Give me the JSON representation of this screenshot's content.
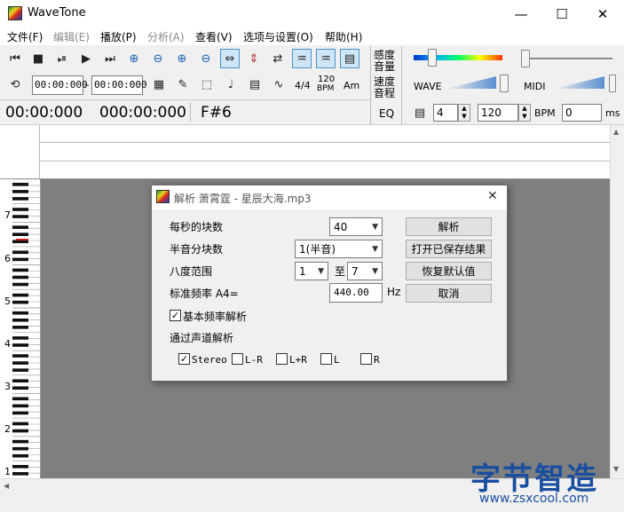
{
  "window": {
    "title": "WaveTone",
    "minimize": "—",
    "maximize": "☐",
    "close": "✕"
  },
  "menu": [
    {
      "label": "文件(F)",
      "enabled": true
    },
    {
      "label": "编辑(E)",
      "enabled": false
    },
    {
      "label": "播放(P)",
      "enabled": true
    },
    {
      "label": "分析(A)",
      "enabled": false
    },
    {
      "label": "查看(V)",
      "enabled": true
    },
    {
      "label": "选项与设置(O)",
      "enabled": true
    },
    {
      "label": "帮助(H)",
      "enabled": true
    }
  ],
  "toolbar": {
    "row1_icons": [
      "rewind-icon",
      "stop-icon",
      "pause-icon",
      "play-icon",
      "fast-forward-icon",
      "zoom-in-h-icon",
      "zoom-out-h-icon",
      "zoom-in-v-icon",
      "zoom-out-v-icon",
      "fit-h-icon",
      "fit-v-icon",
      "swap-icon",
      "wave-stereo-icon",
      "wave-mono-icon",
      "book-icon"
    ],
    "loop_icon": "loop-icon",
    "start_time": "00:00:000",
    "end_time": "00:00:000",
    "time_sep": "–",
    "meter_label": "4/4",
    "bpm_label": "120",
    "bpm_sub": "BPM",
    "am_label": "Am",
    "position_time": "00:00:000",
    "length_time": "000:00:000",
    "note": "F#6",
    "sensitivity_label1": "感度",
    "sensitivity_label2": "音量",
    "speed_label1": "速度",
    "speed_label2": "音程",
    "eq_label": "EQ",
    "wave_label": "WAVE",
    "midi_label": "MIDI",
    "beat_value": "4",
    "bpm_value": "120",
    "bpm_unit": "BPM",
    "ms_value": "0",
    "ms_unit": "ms"
  },
  "piano": {
    "octaves": [
      "7",
      "6",
      "5",
      "4",
      "3",
      "2",
      "1"
    ]
  },
  "dialog": {
    "title": "解析 萧霄霆 - 星辰大海.mp3",
    "close": "✕",
    "blocks_label": "每秒的块数",
    "blocks_value": "40",
    "semitone_label": "半音分块数",
    "semitone_value": "1(半音)",
    "octave_label": "八度范围",
    "octave_from": "1",
    "octave_to_label": "至",
    "octave_to": "7",
    "freq_label": "标准频率 A4=",
    "freq_value": "440.00",
    "freq_unit": "Hz",
    "base_freq_label": "基本频率解析",
    "base_freq_checked": true,
    "channel_label": "通过声道解析",
    "channels": [
      {
        "label": "Stereo",
        "checked": true
      },
      {
        "label": "L-R",
        "checked": false
      },
      {
        "label": "L+R",
        "checked": false
      },
      {
        "label": "L",
        "checked": false
      },
      {
        "label": "R",
        "checked": false
      }
    ],
    "btn_analyze": "解析",
    "btn_open": "打开已保存结果",
    "btn_reset": "恢复默认值",
    "btn_cancel": "取消"
  },
  "watermark": {
    "title": "字节智造",
    "url": "www.zsxcool.com"
  }
}
